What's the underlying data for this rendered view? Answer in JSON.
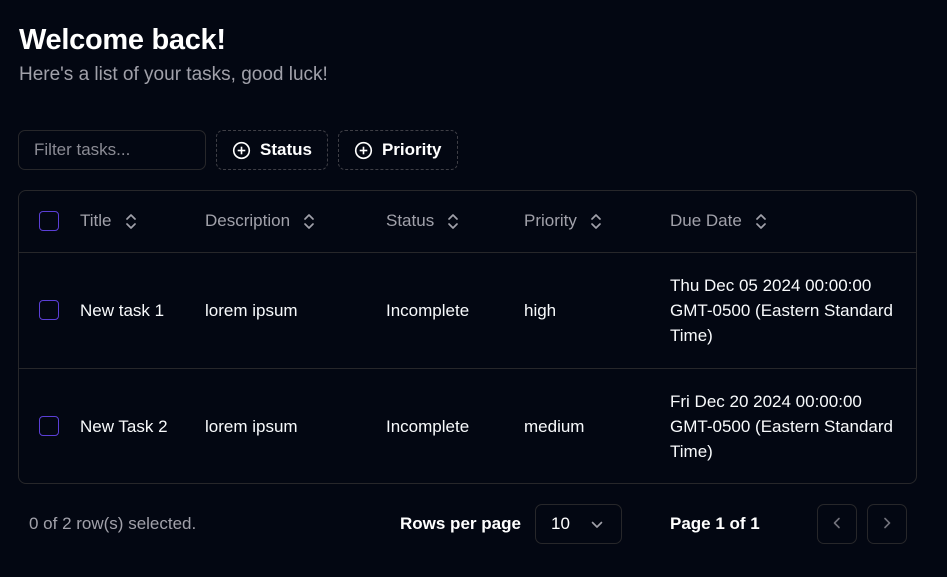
{
  "header": {
    "title": "Welcome back!",
    "subtitle": "Here's a list of your tasks, good luck!"
  },
  "toolbar": {
    "filter_placeholder": "Filter tasks...",
    "filter_value": "",
    "status_filter_label": "Status",
    "priority_filter_label": "Priority"
  },
  "table": {
    "columns": [
      "Title",
      "Description",
      "Status",
      "Priority",
      "Due Date"
    ],
    "rows": [
      {
        "selected": false,
        "title": "New task 1",
        "description": "lorem ipsum",
        "status": "Incomplete",
        "priority": "high",
        "due_date": "Thu Dec 05 2024 00:00:00 GMT-0500 (Eastern Standard Time)"
      },
      {
        "selected": false,
        "title": "New Task 2",
        "description": "lorem ipsum",
        "status": "Incomplete",
        "priority": "medium",
        "due_date": "Fri Dec 20 2024 00:00:00 GMT-0500 (Eastern Standard Time)"
      }
    ]
  },
  "footer": {
    "selected_text": "0 of 2 row(s) selected.",
    "rows_per_page_label": "Rows per page",
    "rows_per_page_value": "10",
    "page_text": "Page 1 of 1"
  },
  "icons": {
    "filter_add": "plus-circle-icon",
    "sort": "chevron-up-down-icon",
    "select": "chevron-down-icon",
    "prev": "chevron-left-icon",
    "next": "chevron-right-icon"
  },
  "colors": {
    "background": "#030712",
    "border": "#27272a",
    "muted_text": "#a1a1aa",
    "checkbox_accent": "#5b3fd6"
  }
}
